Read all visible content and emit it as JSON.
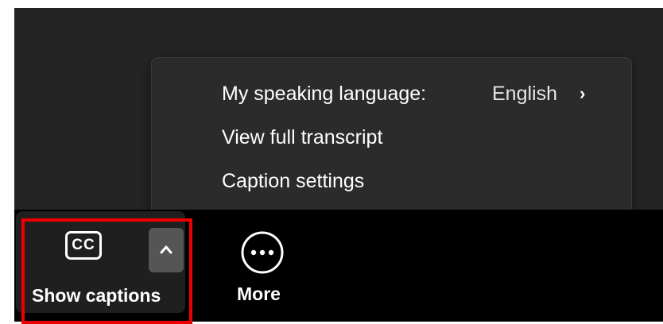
{
  "menu": {
    "items": [
      {
        "label": "My speaking language:",
        "value": "English",
        "chevron": "chevron-right-icon"
      },
      {
        "label": "View full transcript"
      },
      {
        "label": "Caption settings"
      }
    ]
  },
  "toolbar": {
    "captions": {
      "icon_text": "CC",
      "label": "Show captions"
    },
    "more": {
      "label": "More",
      "icon": "more-icon"
    }
  },
  "colors": {
    "highlight": "#ee0000",
    "menu_bg": "#2b2b2b",
    "toolbar_bg": "#000000",
    "caret_bg": "#555555"
  }
}
